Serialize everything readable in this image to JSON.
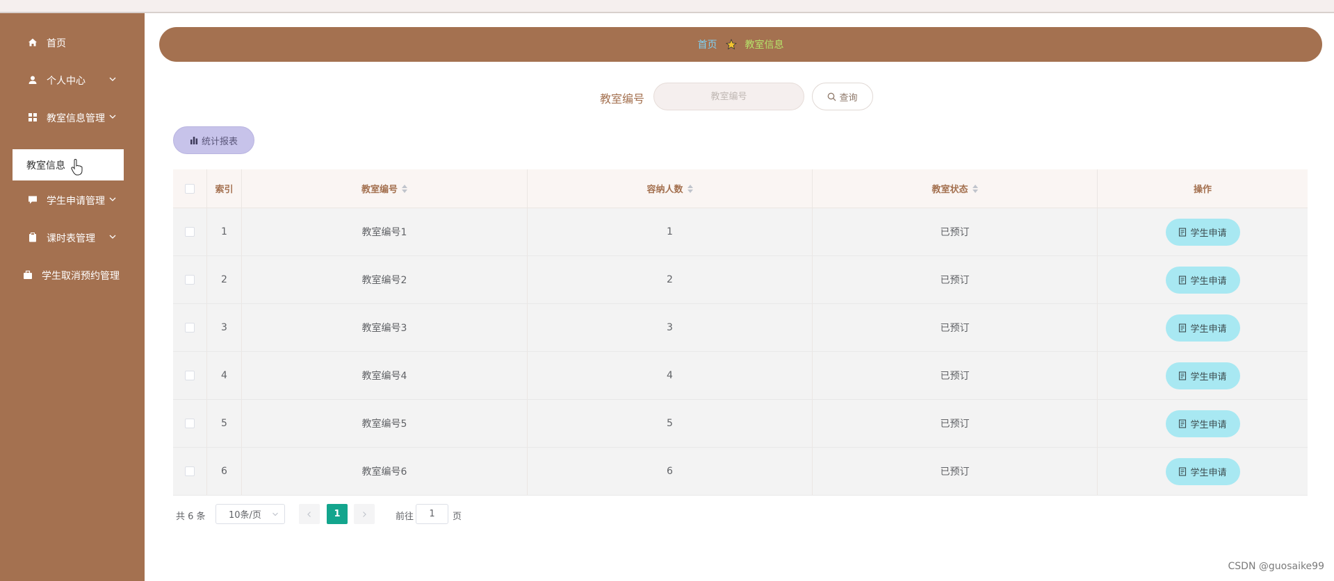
{
  "sidebar": {
    "items": [
      {
        "label": "首页",
        "icon": "home-icon"
      },
      {
        "label": "个人中心",
        "icon": "user-icon"
      },
      {
        "label": "教室信息管理",
        "icon": "grid-icon"
      },
      {
        "label": "学生申请管理",
        "icon": "chat-icon"
      },
      {
        "label": "课时表管理",
        "icon": "clipboard-icon"
      },
      {
        "label": "学生取消预约管理",
        "icon": "briefcase-icon"
      }
    ],
    "active_sub": "教室信息"
  },
  "breadcrumb": {
    "home": "首页",
    "current": "教室信息"
  },
  "search": {
    "label": "教室编号",
    "placeholder": "教室编号",
    "value": "",
    "button": "查询"
  },
  "toolbar": {
    "stats_label": "统计报表"
  },
  "table": {
    "headers": [
      "索引",
      "教室编号",
      "容纳人数",
      "教室状态",
      "操作"
    ],
    "rows": [
      {
        "index": "1",
        "code": "教室编号1",
        "capacity": "1",
        "status": "已预订",
        "action": "学生申请"
      },
      {
        "index": "2",
        "code": "教室编号2",
        "capacity": "2",
        "status": "已预订",
        "action": "学生申请"
      },
      {
        "index": "3",
        "code": "教室编号3",
        "capacity": "3",
        "status": "已预订",
        "action": "学生申请"
      },
      {
        "index": "4",
        "code": "教室编号4",
        "capacity": "4",
        "status": "已预订",
        "action": "学生申请"
      },
      {
        "index": "5",
        "code": "教室编号5",
        "capacity": "5",
        "status": "已预订",
        "action": "学生申请"
      },
      {
        "index": "6",
        "code": "教室编号6",
        "capacity": "6",
        "status": "已预订",
        "action": "学生申请"
      }
    ]
  },
  "pagination": {
    "total": "共 6 条",
    "page_size": "10条/页",
    "current_page": "1",
    "goto_label": "前往",
    "goto_value": "1",
    "goto_suffix": "页"
  },
  "watermark": "CSDN @guosaike99",
  "colors": {
    "sidebar": "#a47150",
    "breadcrumb_home": "#7fd0f2",
    "breadcrumb_current": "#b6e36a",
    "stats_button": "#c7c3ea",
    "apply_button": "#a8e8f2",
    "active_page": "#13a58d"
  }
}
